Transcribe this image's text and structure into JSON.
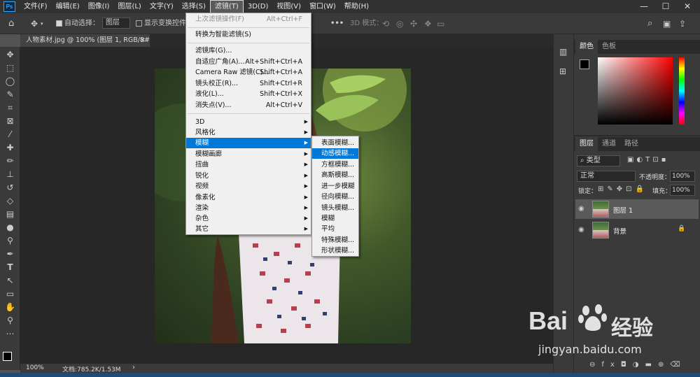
{
  "menubar": {
    "logo": "Ps",
    "items": [
      "文件(F)",
      "编辑(E)",
      "图像(I)",
      "图层(L)",
      "文字(Y)",
      "选择(S)",
      "滤镜(T)",
      "3D(D)",
      "视图(V)",
      "窗口(W)",
      "帮助(H)"
    ],
    "active_index": 6
  },
  "window_controls": {
    "minimize": "—",
    "maximize": "☐",
    "close": "✕"
  },
  "options_bar": {
    "auto_select_label": "自动选择：",
    "auto_select_value": "图层",
    "show_transform_label": "显示变换控件",
    "more": "•••",
    "mode_3d_label": "3D 模式："
  },
  "document_tab": {
    "title": "人物素材.jpg @ 100% (图层 1, RGB/8#) *",
    "close": "×"
  },
  "status_bar": {
    "zoom": "100%",
    "doc_info": "文档:785.2K/1.53M",
    "arrow": "›"
  },
  "filter_menu": {
    "group1": [
      {
        "label": "上次滤镜操作(F)",
        "shortcut": "Alt+Ctrl+F",
        "disabled": true
      }
    ],
    "group2": [
      {
        "label": "转换为智能滤镜(S)",
        "shortcut": ""
      }
    ],
    "group3": [
      {
        "label": "滤镜库(G)...",
        "shortcut": ""
      },
      {
        "label": "自适应广角(A)...",
        "shortcut": "Alt+Shift+Ctrl+A"
      },
      {
        "label": "Camera Raw 滤镜(C)...",
        "shortcut": "Shift+Ctrl+A"
      },
      {
        "label": "镜头校正(R)...",
        "shortcut": "Shift+Ctrl+R"
      },
      {
        "label": "液化(L)...",
        "shortcut": "Shift+Ctrl+X"
      },
      {
        "label": "消失点(V)...",
        "shortcut": "Alt+Ctrl+V"
      }
    ],
    "group4": [
      {
        "label": "3D"
      },
      {
        "label": "风格化"
      },
      {
        "label": "模糊",
        "highlight": true
      },
      {
        "label": "模糊画廊"
      },
      {
        "label": "扭曲"
      },
      {
        "label": "锐化"
      },
      {
        "label": "视频"
      },
      {
        "label": "像素化"
      },
      {
        "label": "渲染"
      },
      {
        "label": "杂色"
      },
      {
        "label": "其它"
      }
    ]
  },
  "blur_submenu": {
    "items": [
      {
        "label": "表面模糊..."
      },
      {
        "label": "动感模糊...",
        "highlight": true
      },
      {
        "label": "方框模糊..."
      },
      {
        "label": "高斯模糊..."
      },
      {
        "label": "进一步模糊"
      },
      {
        "label": "径向模糊..."
      },
      {
        "label": "镜头模糊..."
      },
      {
        "label": "模糊"
      },
      {
        "label": "平均"
      },
      {
        "label": "特殊模糊..."
      },
      {
        "label": "形状模糊..."
      }
    ]
  },
  "color_panel": {
    "tabs": [
      "颜色",
      "色板"
    ],
    "foreground": "#000000",
    "background": "#ffffff"
  },
  "layers_panel": {
    "tabs": [
      "图层",
      "通道",
      "路径"
    ],
    "filter_label": "类型",
    "blend_mode": "正常",
    "opacity_label": "不透明度：",
    "opacity_value": "100%",
    "lock_label": "锁定：",
    "fill_label": "填充：",
    "fill_value": "100%",
    "layers": [
      {
        "name": "图层 1",
        "selected": true,
        "locked": false
      },
      {
        "name": "背景",
        "selected": false,
        "locked": true
      }
    ],
    "footer_icons": [
      "link-icon",
      "fx-icon",
      "mask-icon",
      "adjustment-icon",
      "folder-icon",
      "new-layer-icon",
      "trash-icon"
    ],
    "footer_fx": "fx"
  },
  "watermark": {
    "brand_left": "Bai",
    "brand_right": "经验",
    "url": "jingyan.baidu.com"
  },
  "colors": {
    "accent": "#0078d7",
    "menu_bg": "#f0f0f0",
    "ui_dark": "#323232",
    "panel": "#3a3a3a"
  }
}
